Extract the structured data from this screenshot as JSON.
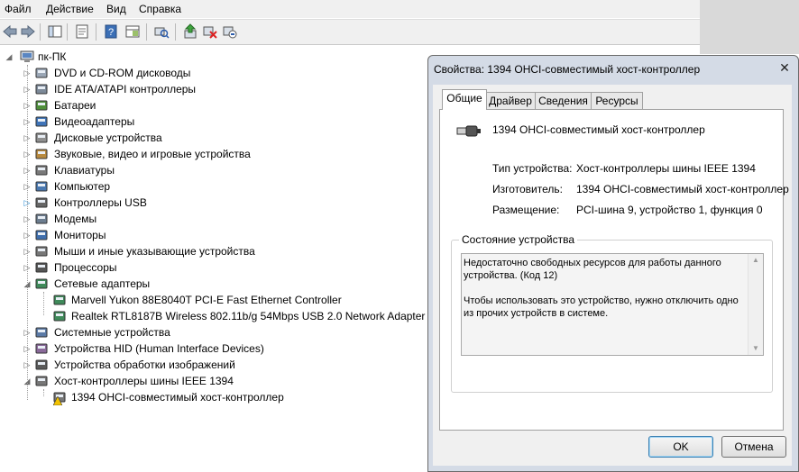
{
  "menu": [
    "Файл",
    "Действие",
    "Вид",
    "Справка"
  ],
  "toolbar": {
    "buttons": [
      "back-arrow-icon",
      "forward-arrow-icon",
      "console-tree-icon",
      "properties-icon",
      "help-icon",
      "show-hide-icon",
      "scan-hardware-icon",
      "update-driver-icon",
      "uninstall-icon",
      "disable-icon"
    ]
  },
  "tree": {
    "root": "пк-ПК",
    "items": [
      {
        "label": "DVD и CD-ROM дисководы",
        "icon": "dvd-icon"
      },
      {
        "label": "IDE ATA/ATAPI контроллеры",
        "icon": "ide-icon"
      },
      {
        "label": "Батареи",
        "icon": "battery-icon"
      },
      {
        "label": "Видеоадаптеры",
        "icon": "display-adapter-icon"
      },
      {
        "label": "Дисковые устройства",
        "icon": "disk-icon"
      },
      {
        "label": "Звуковые, видео и игровые устройства",
        "icon": "sound-icon"
      },
      {
        "label": "Клавиатуры",
        "icon": "keyboard-icon"
      },
      {
        "label": "Компьютер",
        "icon": "computer-icon"
      },
      {
        "label": "Контроллеры USB",
        "icon": "usb-icon"
      },
      {
        "label": "Модемы",
        "icon": "modem-icon"
      },
      {
        "label": "Мониторы",
        "icon": "monitor-icon"
      },
      {
        "label": "Мыши и иные указывающие устройства",
        "icon": "mouse-icon"
      },
      {
        "label": "Процессоры",
        "icon": "processor-icon"
      },
      {
        "label": "Сетевые адаптеры",
        "icon": "network-icon"
      }
    ],
    "network_children": [
      "Marvell Yukon 88E8040T PCI-E Fast Ethernet Controller",
      "Realtek RTL8187B Wireless 802.11b/g 54Mbps USB 2.0 Network Adapter"
    ],
    "items2": [
      {
        "label": "Системные устройства",
        "icon": "system-icon"
      },
      {
        "label": "Устройства HID (Human Interface Devices)",
        "icon": "hid-icon"
      },
      {
        "label": "Устройства обработки изображений",
        "icon": "imaging-icon"
      },
      {
        "label": "Хост-контроллеры шины IEEE 1394",
        "icon": "ieee1394-icon"
      }
    ],
    "ieee_children": [
      "1394 OHCI-совместимый хост-контроллер"
    ]
  },
  "dialog": {
    "title": "Свойства: 1394 OHCI-совместимый хост-контроллер",
    "close": "✕",
    "tabs": [
      "Общие",
      "Драйвер",
      "Сведения",
      "Ресурсы"
    ],
    "device_name": "1394 OHCI-совместимый хост-контроллер",
    "props": [
      {
        "label": "Тип устройства:",
        "value": "Хост-контроллеры шины IEEE 1394"
      },
      {
        "label": "Изготовитель:",
        "value": "1394 OHCI-совместимый хост-контроллер"
      },
      {
        "label": "Размещение:",
        "value": "PCI-шина 9, устройство 1, функция 0"
      }
    ],
    "status_title": "Состояние устройства",
    "status_text": "Недостаточно свободных ресурсов для работы данного устройства. (Код 12)\n\nЧтобы использовать это устройство, нужно отключить одно из прочих устройств в системе.",
    "ok": "OK",
    "cancel": "Отмена"
  },
  "colors": {
    "warning": "#f2c200",
    "accent": "#3c7fb1"
  }
}
